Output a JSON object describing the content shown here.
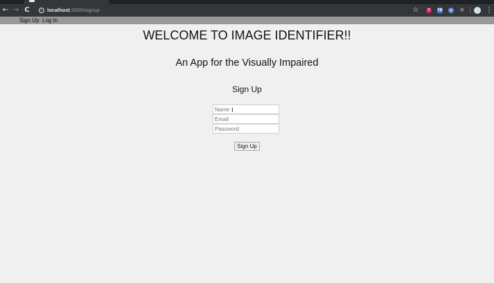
{
  "browser": {
    "url_host": "localhost",
    "url_path": ":3000/signup",
    "nav_back": "←",
    "nav_forward": "→",
    "nav_reload": "C",
    "info_glyph": "i",
    "star_glyph": "☆",
    "menu_glyph": "⋮",
    "extensions": [
      {
        "label": "T",
        "color": "#e0245e",
        "icon": "extension-t-icon"
      },
      {
        "label": "FB",
        "color": "#3b82d6",
        "icon": "extension-fb-icon"
      },
      {
        "label": "●",
        "color": "#5b8fd6",
        "icon": "extension-blue-icon"
      },
      {
        "label": "⚛",
        "color": "#35363a",
        "icon": "react-devtools-icon"
      }
    ]
  },
  "nav": {
    "signup_link": "Sign Up",
    "login_link": "Log In"
  },
  "main": {
    "title": "WELCOME TO IMAGE IDENTIFIER!!",
    "subtitle": "An App for the Visually Impaired"
  },
  "form": {
    "heading": "Sign Up",
    "name_placeholder": "Name",
    "email_placeholder": "Email",
    "password_placeholder": "Password",
    "submit_label": "Sign Up",
    "cursor_glyph": "I"
  }
}
